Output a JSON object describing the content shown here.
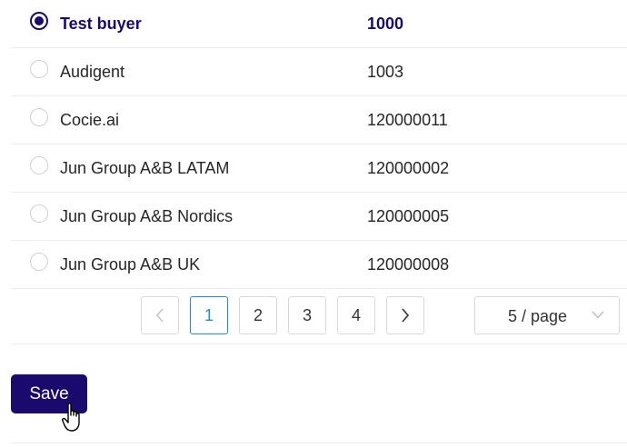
{
  "rows": [
    {
      "name": "Test buyer",
      "id": "1000",
      "selected": true
    },
    {
      "name": "Audigent",
      "id": "1003",
      "selected": false
    },
    {
      "name": "Cocie.ai",
      "id": "120000011",
      "selected": false
    },
    {
      "name": "Jun Group A&B LATAM",
      "id": "120000002",
      "selected": false
    },
    {
      "name": "Jun Group A&B Nordics",
      "id": "120000005",
      "selected": false
    },
    {
      "name": "Jun Group A&B UK",
      "id": "120000008",
      "selected": false
    }
  ],
  "pagination": {
    "pages": [
      "1",
      "2",
      "3",
      "4"
    ],
    "current": "1",
    "page_size": "5 / page"
  },
  "save_label": "Save",
  "colors": {
    "primary": "#1b0a6e",
    "active_page": "#1a8fd2",
    "border": "#d9d9d9"
  }
}
